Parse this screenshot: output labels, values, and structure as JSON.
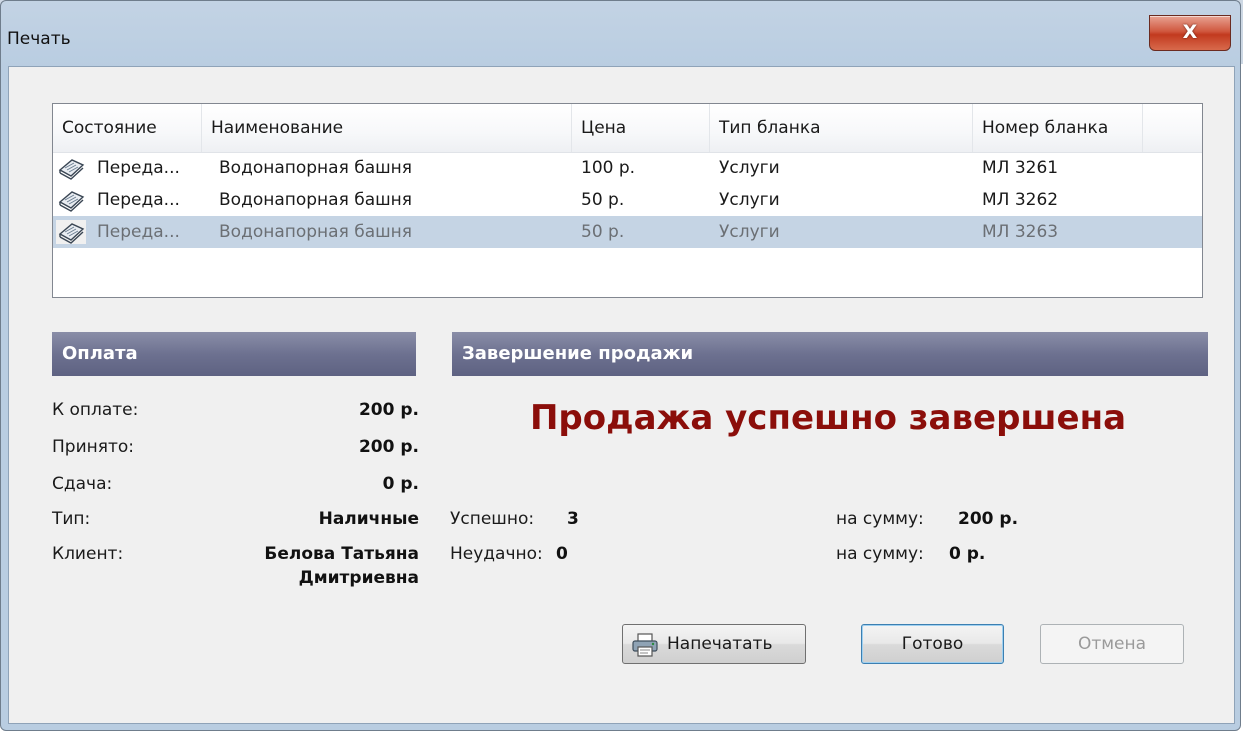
{
  "window": {
    "title": "Печать",
    "close_glyph": "X"
  },
  "table": {
    "columns": [
      "Состояние",
      "Наименование",
      "Цена",
      "Тип бланка",
      "Номер бланка"
    ],
    "rows": [
      {
        "status": "Переда...",
        "name": "Водонапорная башня",
        "price": "100 р.",
        "form_type": "Услуги",
        "form_number": "МЛ 3261",
        "icon": "document-stack-icon",
        "selected": false
      },
      {
        "status": "Переда...",
        "name": "Водонапорная башня",
        "price": "50 р.",
        "form_type": "Услуги",
        "form_number": "МЛ 3262",
        "icon": "document-stack-icon",
        "selected": false
      },
      {
        "status": "Переда...",
        "name": "Водонапорная башня",
        "price": "50 р.",
        "form_type": "Услуги",
        "form_number": "МЛ 3263",
        "icon": "document-stack-icon",
        "selected": true
      }
    ]
  },
  "payment": {
    "header": "Оплата",
    "due_label": "К оплате:",
    "due_value": "200 р.",
    "accepted_label": "Принято:",
    "accepted_value": "200 р.",
    "change_label": "Сдача:",
    "change_value": "0 р.",
    "type_label": "Тип:",
    "type_value": "Наличные",
    "client_label": "Клиент:",
    "client_value_line1": "Белова Татьяна",
    "client_value_line2": "Дмитриевна"
  },
  "completion": {
    "header": "Завершение продажи",
    "status": "Продажа успешно завершена",
    "success_label": "Успешно:",
    "success_count": "3",
    "success_sum_label": "на сумму:",
    "success_sum": "200 р.",
    "fail_label": "Неудачно:",
    "fail_count": "0",
    "fail_sum_label": "на сумму:",
    "fail_sum": "0 р."
  },
  "buttons": {
    "print": "Напечатать",
    "done": "Готово",
    "cancel": "Отмена"
  },
  "colors": {
    "status_text": "#8b0e0a",
    "section_header": "#6d7190",
    "selection": "#c5d4e4"
  }
}
